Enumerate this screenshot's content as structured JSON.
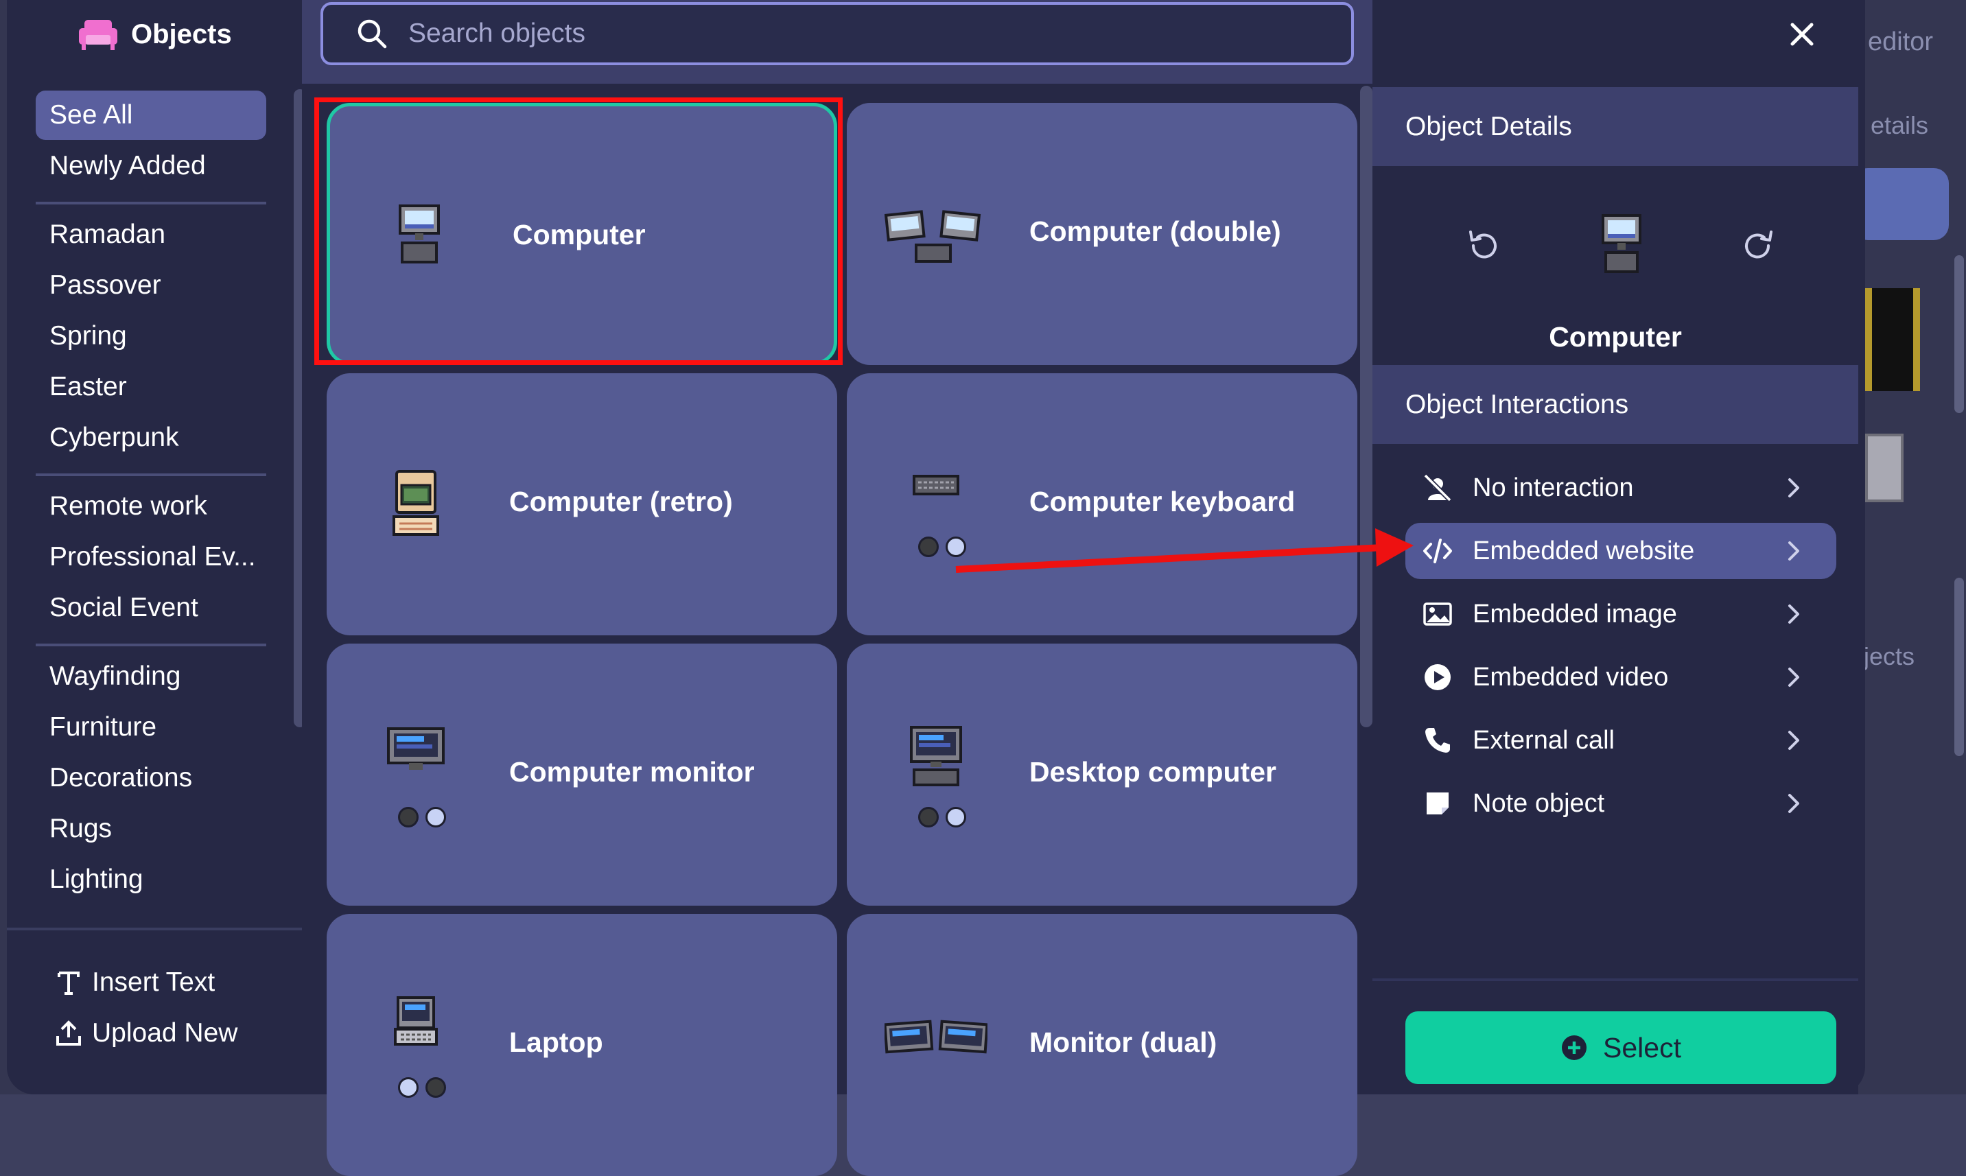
{
  "backdrop": {
    "editor_text": "editor",
    "details_text": "etails",
    "objects_text": "jects"
  },
  "sidebar": {
    "title": "Objects",
    "groups": [
      [
        "See All",
        "Newly Added"
      ],
      [
        "Ramadan",
        "Passover",
        "Spring",
        "Easter",
        "Cyberpunk"
      ],
      [
        "Remote work",
        "Professional Ev...",
        "Social Event"
      ],
      [
        "Wayfinding",
        "Furniture",
        "Decorations",
        "Rugs",
        "Lighting"
      ]
    ],
    "active": "See All",
    "insert_text": "Insert Text",
    "upload_new": "Upload New"
  },
  "search": {
    "placeholder": "Search objects",
    "value": ""
  },
  "objects": [
    {
      "name": "Computer",
      "icon": "computer-icon",
      "variants": []
    },
    {
      "name": "Computer (double)",
      "icon": "computer-double-icon",
      "variants": []
    },
    {
      "name": "Computer (retro)",
      "icon": "computer-retro-icon",
      "variants": []
    },
    {
      "name": "Computer keyboard",
      "icon": "keyboard-icon",
      "variants": [
        "dark",
        "light"
      ]
    },
    {
      "name": "Computer monitor",
      "icon": "monitor-icon",
      "variants": [
        "dark",
        "light"
      ]
    },
    {
      "name": "Desktop computer",
      "icon": "desktop-computer-icon",
      "variants": [
        "dark",
        "light"
      ]
    },
    {
      "name": "Laptop",
      "icon": "laptop-icon",
      "variants": [
        "light",
        "dark"
      ]
    },
    {
      "name": "Monitor (dual)",
      "icon": "monitor-dual-icon",
      "variants": []
    }
  ],
  "selected_object": "Computer",
  "details": {
    "header": "Object Details",
    "object_name": "Computer",
    "interactions_header": "Object Interactions",
    "interactions": [
      {
        "label": "No interaction",
        "icon": "user-slash-icon"
      },
      {
        "label": "Embedded website",
        "icon": "code-icon"
      },
      {
        "label": "Embedded image",
        "icon": "image-icon"
      },
      {
        "label": "Embedded video",
        "icon": "play-icon"
      },
      {
        "label": "External call",
        "icon": "phone-icon"
      },
      {
        "label": "Note object",
        "icon": "note-icon"
      }
    ],
    "active_interaction": "Embedded website",
    "select_label": "Select"
  },
  "colors": {
    "accent": "#10cea0",
    "panel": "#262845",
    "card": "#555b93",
    "highlight": "#ff1010"
  }
}
